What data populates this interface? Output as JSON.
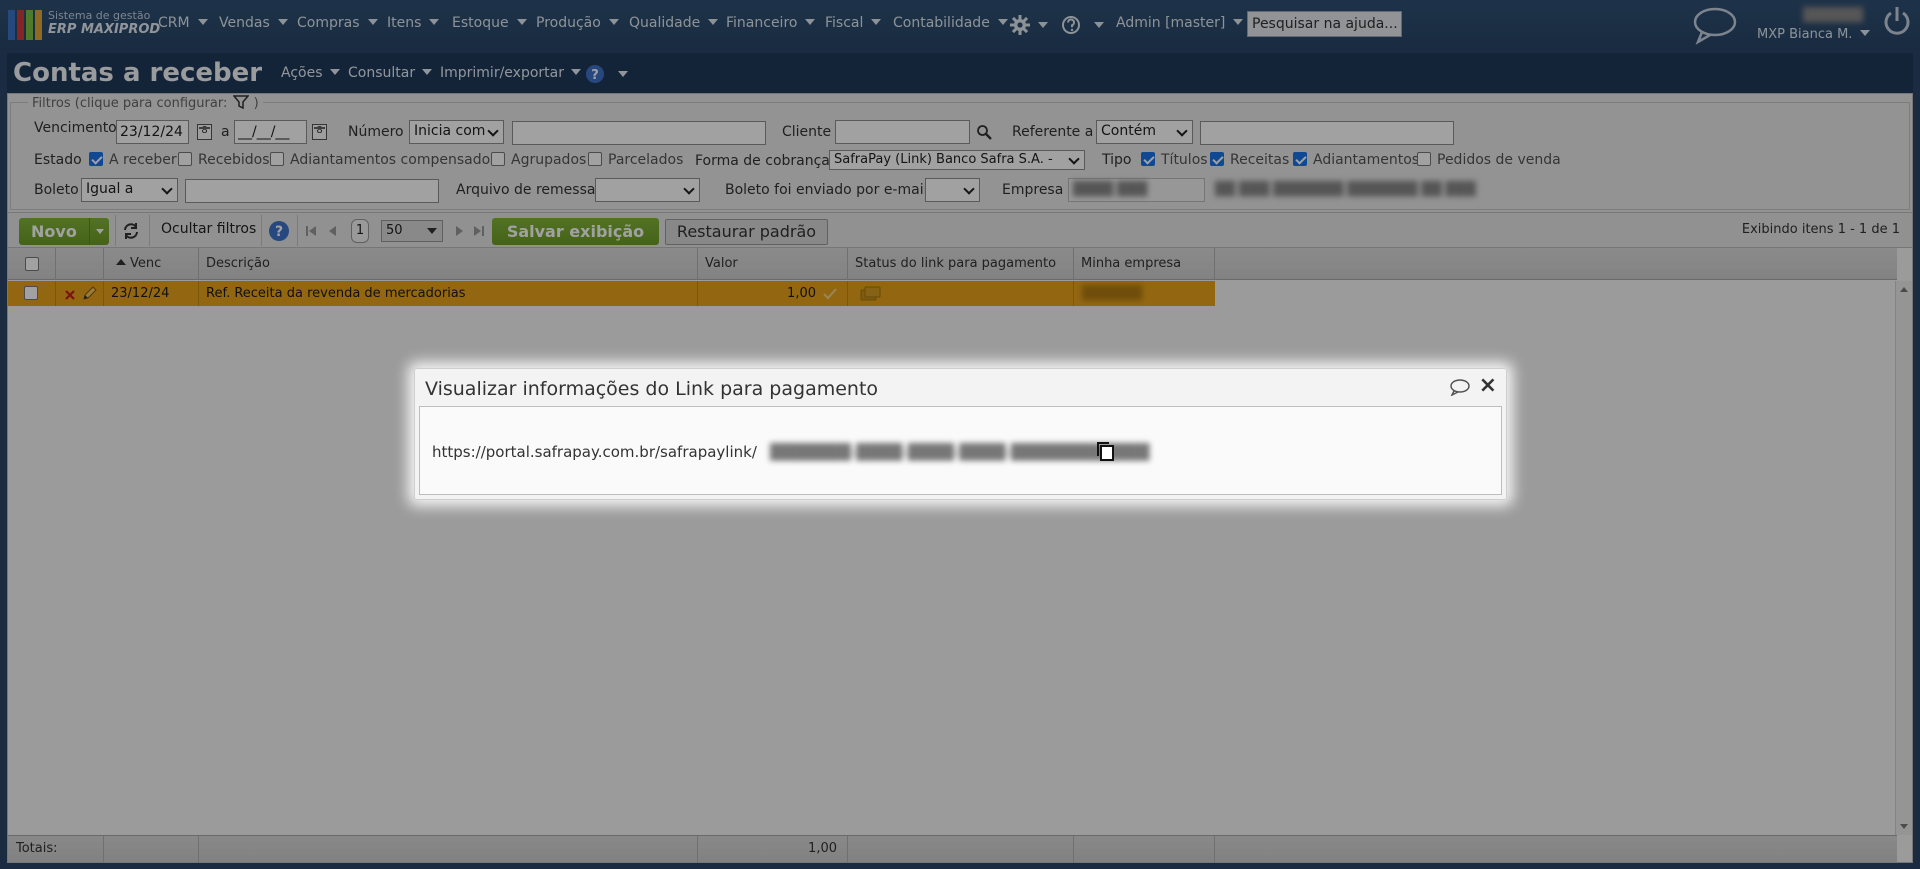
{
  "app": {
    "logo_line1": "Sistema de gestão",
    "logo_line2": "ERP MAXIPROD"
  },
  "nav": {
    "items": [
      "CRM",
      "Vendas",
      "Compras",
      "Itens",
      "Estoque",
      "Produção",
      "Qualidade",
      "Financeiro",
      "Fiscal",
      "Contabilidade"
    ],
    "admin": "Admin [master]",
    "help_placeholder": "Pesquisar na ajuda...",
    "user": "MXP Bianca M."
  },
  "page": {
    "title": "Contas a receber",
    "menus": [
      "Ações",
      "Consultar",
      "Imprimir/exportar"
    ]
  },
  "filters": {
    "legend": "Filtros (clique para configurar:",
    "legend_end": ")",
    "vencimento_label": "Vencimento",
    "vencimento_from": "23/12/24",
    "range_sep": "a",
    "vencimento_to": "__/__/__",
    "numero_label": "Número",
    "numero_mode": "Inicia com",
    "cliente_label": "Cliente",
    "referente_label": "Referente a",
    "referente_mode": "Contém",
    "estado_label": "Estado",
    "estado_options": [
      {
        "label": "A receber",
        "checked": true
      },
      {
        "label": "Recebidos",
        "checked": false
      },
      {
        "label": "Adiantamentos compensados",
        "checked": false
      },
      {
        "label": "Agrupados",
        "checked": false
      },
      {
        "label": "Parcelados",
        "checked": false
      }
    ],
    "forma_label": "Forma de cobrança",
    "forma_value": "SafraPay (Link) Banco Safra S.A. -",
    "tipo_label": "Tipo",
    "tipo_options": [
      {
        "label": "Títulos",
        "checked": true
      },
      {
        "label": "Receitas",
        "checked": true
      },
      {
        "label": "Adiantamentos",
        "checked": true
      },
      {
        "label": "Pedidos de venda",
        "checked": false
      }
    ],
    "boleto_label": "Boleto",
    "boleto_mode": "Igual a",
    "arquivo_label": "Arquivo de remessa",
    "enviado_label": "Boleto foi enviado por e-mail",
    "empresa_label": "Empresa"
  },
  "toolbar": {
    "novo": "Novo",
    "hide_filters": "Ocultar filtros",
    "page": "1",
    "page_size": "50",
    "save_view": "Salvar exibição",
    "restore": "Restaurar padrão",
    "count": "Exibindo itens 1 - 1 de 1"
  },
  "grid": {
    "columns": [
      "Venc",
      "Descrição",
      "Valor",
      "Status do link para pagamento",
      "Minha empresa"
    ],
    "rows": [
      {
        "venc": "23/12/24",
        "descricao": "Ref. Receita da revenda de mercadorias",
        "valor": "1,00"
      }
    ],
    "totals_label": "Totais:",
    "totals_valor": "1,00"
  },
  "modal": {
    "title": "Visualizar informações do Link para pagamento",
    "close": "×",
    "url": "https://portal.safrapay.com.br/safrapaylink/"
  },
  "colors": {
    "nav_bg": "#2a4569",
    "row_highlight": "#e9a31e",
    "button_green": "#78a92f"
  }
}
